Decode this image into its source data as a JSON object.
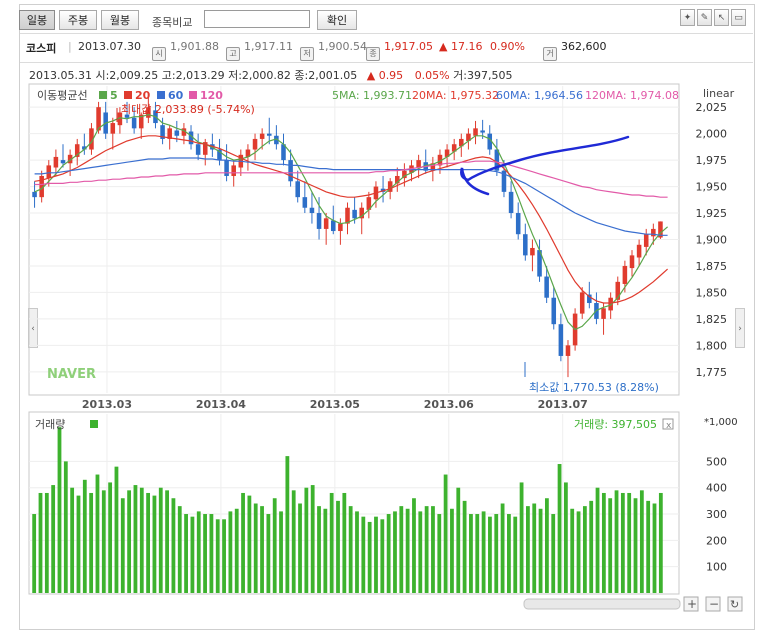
{
  "toolbar": {
    "tab_daily": "일봉",
    "tab_weekly": "주봉",
    "tab_monthly": "월봉",
    "compare_label": "종목비교",
    "compare_input": "",
    "confirm": "확인"
  },
  "quote": {
    "name": "코스피",
    "date": "2013.07.30",
    "open_label": "시",
    "open": "1,901.88",
    "high_label": "고",
    "high": "1,917.11",
    "low_label": "저",
    "low": "1,900.54",
    "close_label": "종",
    "close": "1,917.05",
    "change": "▲ 17.16",
    "change_pct": "0.90%",
    "vol_label": "거",
    "volume": "362,600"
  },
  "info_line": {
    "date": "2013.05.31",
    "open": "시:2,009.25",
    "high": "고:2,013.29",
    "low": "저:2,000.82",
    "close": "종:2,001.05",
    "change": "▲ 0.95",
    "pct": "0.05%",
    "vol": "거:397,505"
  },
  "ma_legend": {
    "title": "이동평균선",
    "p5": "5",
    "p20": "20",
    "p60": "60",
    "p120": "120",
    "v5": "5MA: 1,993.71",
    "v20": "20MA: 1,975.32",
    "v60": "60MA: 1,964.56",
    "v120": "120MA: 1,974.08"
  },
  "scale_label": "linear",
  "max_annotation": "최대값 2,033.89 (-5.74%)",
  "min_annotation": "최소값 1,770.53 (8.28%)",
  "watermark": "NAVER",
  "volume_panel": {
    "title": "거래량",
    "value_label": "거래량: 397,505",
    "unit": "*1,000"
  },
  "colors": {
    "up": "#e03b2e",
    "down": "#2d6fc8",
    "ma5": "#5aa64a",
    "ma20": "#e03b2e",
    "ma60": "#3a6fd0",
    "ma120": "#e25aa8",
    "volume": "#3db22e",
    "pen": "#1f2ad6"
  },
  "chart_data": [
    {
      "type": "candlestick",
      "x_ticks": [
        "2013.03",
        "2013.04",
        "2013.05",
        "2013.06",
        "2013.07"
      ],
      "y_ticks": [
        1775,
        1800,
        1825,
        1850,
        1875,
        1900,
        1925,
        1950,
        1975,
        2000,
        2025
      ],
      "ylim": [
        1755,
        2045
      ],
      "ohlc": [
        [
          1945,
          1955,
          1930,
          1940
        ],
        [
          1940,
          1965,
          1935,
          1960
        ],
        [
          1958,
          1975,
          1950,
          1970
        ],
        [
          1968,
          1985,
          1960,
          1978
        ],
        [
          1975,
          1990,
          1968,
          1972
        ],
        [
          1972,
          1985,
          1960,
          1980
        ],
        [
          1978,
          1995,
          1970,
          1990
        ],
        [
          1988,
          2000,
          1980,
          1985
        ],
        [
          1985,
          2010,
          1980,
          2005
        ],
        [
          2003,
          2030,
          2000,
          2025
        ],
        [
          2020,
          2030,
          1995,
          2000
        ],
        [
          2000,
          2015,
          1985,
          2010
        ],
        [
          2008,
          2025,
          2000,
          2020
        ],
        [
          2018,
          2030,
          2010,
          2015
        ],
        [
          2015,
          2025,
          2000,
          2005
        ],
        [
          2005,
          2020,
          1995,
          2018
        ],
        [
          2015,
          2034,
          2010,
          2025
        ],
        [
          2022,
          2030,
          2005,
          2010
        ],
        [
          2008,
          2015,
          1990,
          1995
        ],
        [
          1995,
          2008,
          1985,
          2005
        ],
        [
          2003,
          2012,
          1992,
          1998
        ],
        [
          1998,
          2010,
          1990,
          2005
        ],
        [
          2002,
          2008,
          1985,
          1990
        ],
        [
          1990,
          2000,
          1975,
          1980
        ],
        [
          1980,
          1995,
          1970,
          1992
        ],
        [
          1990,
          2000,
          1978,
          1985
        ],
        [
          1985,
          1995,
          1970,
          1975
        ],
        [
          1975,
          1990,
          1955,
          1960
        ],
        [
          1960,
          1975,
          1950,
          1970
        ],
        [
          1968,
          1985,
          1960,
          1980
        ],
        [
          1978,
          1990,
          1965,
          1985
        ],
        [
          1985,
          2000,
          1975,
          1995
        ],
        [
          1995,
          2005,
          1985,
          2000
        ],
        [
          2000,
          2015,
          1990,
          1998
        ],
        [
          1998,
          2008,
          1985,
          1990
        ],
        [
          1990,
          2000,
          1970,
          1975
        ],
        [
          1975,
          1985,
          1950,
          1955
        ],
        [
          1955,
          1965,
          1935,
          1940
        ],
        [
          1940,
          1955,
          1925,
          1930
        ],
        [
          1930,
          1945,
          1915,
          1925
        ],
        [
          1925,
          1940,
          1900,
          1910
        ],
        [
          1910,
          1925,
          1895,
          1920
        ],
        [
          1918,
          1932,
          1905,
          1908
        ],
        [
          1908,
          1920,
          1895,
          1915
        ],
        [
          1915,
          1935,
          1905,
          1930
        ],
        [
          1928,
          1940,
          1915,
          1920
        ],
        [
          1920,
          1935,
          1905,
          1930
        ],
        [
          1928,
          1945,
          1920,
          1940
        ],
        [
          1938,
          1955,
          1930,
          1950
        ],
        [
          1948,
          1960,
          1935,
          1945
        ],
        [
          1945,
          1958,
          1938,
          1955
        ],
        [
          1953,
          1968,
          1945,
          1960
        ],
        [
          1958,
          1972,
          1950,
          1965
        ],
        [
          1963,
          1975,
          1955,
          1970
        ],
        [
          1968,
          1980,
          1958,
          1975
        ],
        [
          1973,
          1985,
          1962,
          1965
        ],
        [
          1965,
          1978,
          1955,
          1972
        ],
        [
          1970,
          1985,
          1962,
          1980
        ],
        [
          1978,
          1990,
          1968,
          1985
        ],
        [
          1983,
          1995,
          1975,
          1990
        ],
        [
          1988,
          2000,
          1978,
          1995
        ],
        [
          1993,
          2005,
          1985,
          2000
        ],
        [
          1998,
          2012,
          1990,
          2005
        ],
        [
          2003,
          2013,
          1995,
          2001
        ],
        [
          2000,
          2008,
          1980,
          1985
        ],
        [
          1985,
          1995,
          1960,
          1965
        ],
        [
          1965,
          1975,
          1940,
          1945
        ],
        [
          1945,
          1955,
          1920,
          1925
        ],
        [
          1925,
          1935,
          1900,
          1905
        ],
        [
          1905,
          1915,
          1880,
          1885
        ],
        [
          1885,
          1900,
          1870,
          1892
        ],
        [
          1890,
          1900,
          1860,
          1865
        ],
        [
          1865,
          1875,
          1840,
          1845
        ],
        [
          1845,
          1855,
          1815,
          1820
        ],
        [
          1820,
          1830,
          1785,
          1790
        ],
        [
          1790,
          1805,
          1770,
          1800
        ],
        [
          1800,
          1835,
          1795,
          1830
        ],
        [
          1830,
          1855,
          1825,
          1850
        ],
        [
          1848,
          1860,
          1835,
          1840
        ],
        [
          1840,
          1850,
          1820,
          1825
        ],
        [
          1825,
          1840,
          1810,
          1835
        ],
        [
          1833,
          1850,
          1825,
          1845
        ],
        [
          1843,
          1865,
          1838,
          1860
        ],
        [
          1858,
          1880,
          1850,
          1875
        ],
        [
          1873,
          1890,
          1865,
          1885
        ],
        [
          1883,
          1900,
          1875,
          1895
        ],
        [
          1893,
          1910,
          1885,
          1905
        ],
        [
          1903,
          1915,
          1895,
          1910
        ],
        [
          1901.88,
          1917.11,
          1900.54,
          1917.05
        ]
      ],
      "series": [
        {
          "name": "5",
          "values": [
            1945,
            1948,
            1955,
            1962,
            1970,
            1975,
            1980,
            1985,
            1992,
            2005,
            2010,
            2012,
            2015,
            2014,
            2016,
            2016,
            2018,
            2016,
            2010,
            2008,
            2005,
            2003,
            1998,
            1992,
            1990,
            1987,
            1983,
            1978,
            1975,
            1976,
            1978,
            1982,
            1988,
            1993,
            1995,
            1990,
            1982,
            1970,
            1958,
            1945,
            1932,
            1922,
            1918,
            1915,
            1916,
            1919,
            1922,
            1928,
            1936,
            1942,
            1948,
            1954,
            1960,
            1963,
            1967,
            1970,
            1971,
            1974,
            1978,
            1983,
            1988,
            1993,
            1998,
            1998,
            1995,
            1986,
            1972,
            1957,
            1940,
            1922,
            1905,
            1890,
            1873,
            1855,
            1838,
            1822,
            1815,
            1818,
            1825,
            1833,
            1836,
            1838,
            1845,
            1855,
            1864,
            1875,
            1887,
            1898,
            1906,
            1912
          ]
        },
        {
          "name": "20",
          "values": [
            1955,
            1956,
            1958,
            1960,
            1962,
            1965,
            1968,
            1972,
            1976,
            1980,
            1984,
            1987,
            1990,
            1993,
            1995,
            1997,
            1998,
            1998,
            1997,
            1996,
            1995,
            1994,
            1993,
            1991,
            1990,
            1988,
            1986,
            1983,
            1980,
            1977,
            1974,
            1971,
            1969,
            1967,
            1965,
            1963,
            1960,
            1957,
            1954,
            1951,
            1948,
            1945,
            1943,
            1941,
            1940,
            1940,
            1941,
            1942,
            1944,
            1946,
            1948,
            1951,
            1954,
            1957,
            1960,
            1963,
            1965,
            1967,
            1969,
            1971,
            1973,
            1975,
            1977,
            1978,
            1977,
            1973,
            1967,
            1960,
            1952,
            1943,
            1933,
            1922,
            1910,
            1897,
            1884,
            1871,
            1860,
            1852,
            1846,
            1842,
            1840,
            1840,
            1841,
            1843,
            1846,
            1850,
            1855,
            1860,
            1866,
            1872
          ]
        },
        {
          "name": "60",
          "values": [
            1962,
            1962,
            1963,
            1963,
            1964,
            1965,
            1966,
            1967,
            1968,
            1969,
            1970,
            1971,
            1972,
            1973,
            1974,
            1975,
            1976,
            1976,
            1976,
            1977,
            1977,
            1977,
            1977,
            1977,
            1976,
            1976,
            1975,
            1975,
            1974,
            1974,
            1973,
            1973,
            1972,
            1972,
            1971,
            1971,
            1970,
            1970,
            1969,
            1968,
            1967,
            1967,
            1966,
            1966,
            1966,
            1966,
            1966,
            1966,
            1966,
            1966,
            1966,
            1966,
            1966,
            1966,
            1966,
            1966,
            1966,
            1966,
            1966,
            1966,
            1966,
            1966,
            1966,
            1966,
            1965,
            1964,
            1962,
            1959,
            1956,
            1953,
            1949,
            1945,
            1941,
            1937,
            1933,
            1929,
            1925,
            1922,
            1919,
            1916,
            1914,
            1912,
            1910,
            1908,
            1907,
            1906,
            1905,
            1905,
            1904,
            1904
          ]
        },
        {
          "name": "120",
          "values": [
            1952,
            1952,
            1953,
            1953,
            1953,
            1954,
            1954,
            1955,
            1955,
            1956,
            1956,
            1957,
            1957,
            1958,
            1958,
            1959,
            1959,
            1960,
            1960,
            1961,
            1961,
            1962,
            1962,
            1962,
            1963,
            1963,
            1963,
            1963,
            1963,
            1963,
            1963,
            1963,
            1963,
            1963,
            1963,
            1963,
            1963,
            1963,
            1963,
            1963,
            1963,
            1963,
            1963,
            1963,
            1963,
            1963,
            1963,
            1963,
            1964,
            1964,
            1965,
            1965,
            1966,
            1967,
            1968,
            1969,
            1970,
            1971,
            1972,
            1972,
            1973,
            1973,
            1974,
            1974,
            1974,
            1973,
            1972,
            1970,
            1968,
            1966,
            1964,
            1962,
            1960,
            1958,
            1956,
            1954,
            1952,
            1950,
            1949,
            1947,
            1946,
            1945,
            1944,
            1943,
            1942,
            1942,
            1941,
            1941,
            1940,
            1940
          ]
        }
      ],
      "annotations": [
        "최대값 2,033.89 (-5.74%)",
        "최소값 1,770.53 (8.28%)"
      ]
    },
    {
      "type": "bar",
      "title": "거래량",
      "unit": "*1,000",
      "y_ticks": [
        100,
        200,
        300,
        400,
        500
      ],
      "ylim": [
        0,
        680
      ],
      "values": [
        300,
        380,
        380,
        410,
        630,
        500,
        400,
        370,
        430,
        380,
        450,
        390,
        420,
        480,
        360,
        390,
        410,
        400,
        380,
        370,
        400,
        390,
        360,
        330,
        300,
        290,
        310,
        300,
        300,
        280,
        280,
        310,
        320,
        380,
        370,
        340,
        330,
        300,
        360,
        310,
        520,
        390,
        340,
        400,
        410,
        330,
        320,
        380,
        350,
        380,
        330,
        310,
        290,
        270,
        290,
        280,
        300,
        310,
        330,
        320,
        360,
        310,
        330,
        330,
        300,
        450,
        320,
        400,
        350,
        300,
        300,
        310,
        290,
        300,
        340,
        300,
        290,
        420,
        330,
        340,
        320,
        360,
        300,
        490,
        420,
        320,
        310,
        330,
        350,
        400,
        380,
        360,
        390,
        380,
        380,
        360,
        390,
        350,
        340,
        380
      ]
    }
  ]
}
